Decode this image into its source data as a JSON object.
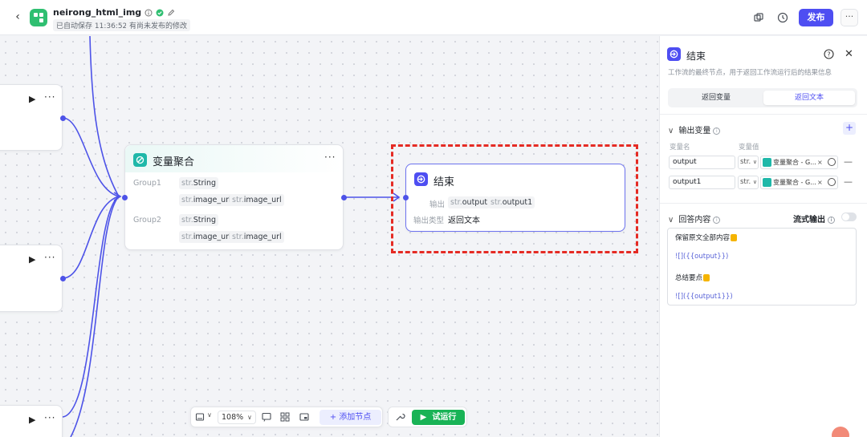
{
  "header": {
    "app_name": "neirong_html_img",
    "save_status": "已自动保存 11:36:52",
    "unpublished": "有尚未发布的修改",
    "publish_label": "发布",
    "more_label": "···"
  },
  "canvas": {
    "left_node_dots": "···",
    "aggregator": {
      "title": "变量聚合",
      "dots": "···",
      "group1_label": "Group1",
      "group2_label": "Group2",
      "group1_tags": [
        {
          "prefix": "str.",
          "name": "String"
        },
        {
          "prefix": "str.",
          "name": "image_url"
        },
        {
          "prefix": "str.",
          "name": "image_url"
        }
      ],
      "group2_tags": [
        {
          "prefix": "str.",
          "name": "String"
        },
        {
          "prefix": "str.",
          "name": "image_url"
        },
        {
          "prefix": "str.",
          "name": "image_url"
        }
      ]
    },
    "end_node": {
      "title": "结束",
      "output_label": "输出",
      "outputs": [
        {
          "prefix": "str.",
          "name": "output"
        },
        {
          "prefix": "str.",
          "name": "output1"
        }
      ],
      "output_type_label": "输出类型",
      "output_type_value": "返回文本"
    }
  },
  "toolbar": {
    "zoom": "108%",
    "add_node": "+ 添加节点",
    "run": "试运行"
  },
  "panel": {
    "title": "结束",
    "description": "工作流的最终节点，用于返回工作流运行后的结果信息",
    "tabs": [
      {
        "label": "返回变量",
        "active": false
      },
      {
        "label": "返回文本",
        "active": true
      }
    ],
    "output_vars_title": "输出变量",
    "col_name": "变量名",
    "col_value": "变量值",
    "vars": [
      {
        "name": "output",
        "type": "str.",
        "ref": "变量聚合 - G...",
        "remove": "×"
      },
      {
        "name": "output1",
        "type": "str.",
        "ref": "变量聚合 - G...",
        "remove": "×"
      }
    ],
    "delete_label": "—",
    "answer_title": "回答内容",
    "stream_label": "流式输出",
    "answer_lines": [
      "保留原文全部内容",
      "![]({{output}})",
      "总结要点",
      "![]({{output1}})"
    ]
  },
  "colors": {
    "accent": "#4e4ef2",
    "run": "#19b356",
    "aggregator": "#1fb8a9",
    "highlight": "#e52b24"
  }
}
